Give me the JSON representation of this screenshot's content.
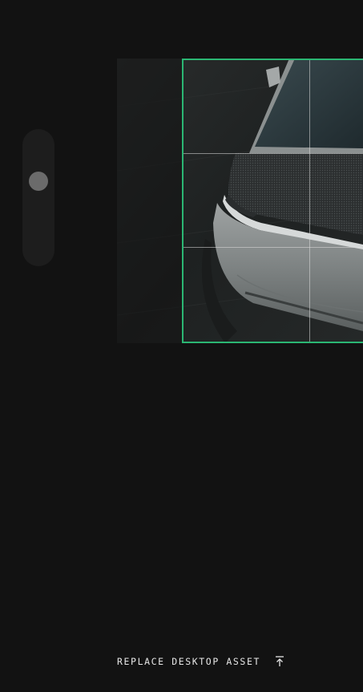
{
  "zoom": {
    "level": 0.66
  },
  "crop": {
    "accent_color": "#2bb673",
    "grid_color": "#dcdcdc",
    "grid": "3x3",
    "image_subject": "car-front-icon"
  },
  "actions": {
    "replace_label": "REPLACE DESKTOP ASSET",
    "replace_icon": "upload-icon"
  }
}
